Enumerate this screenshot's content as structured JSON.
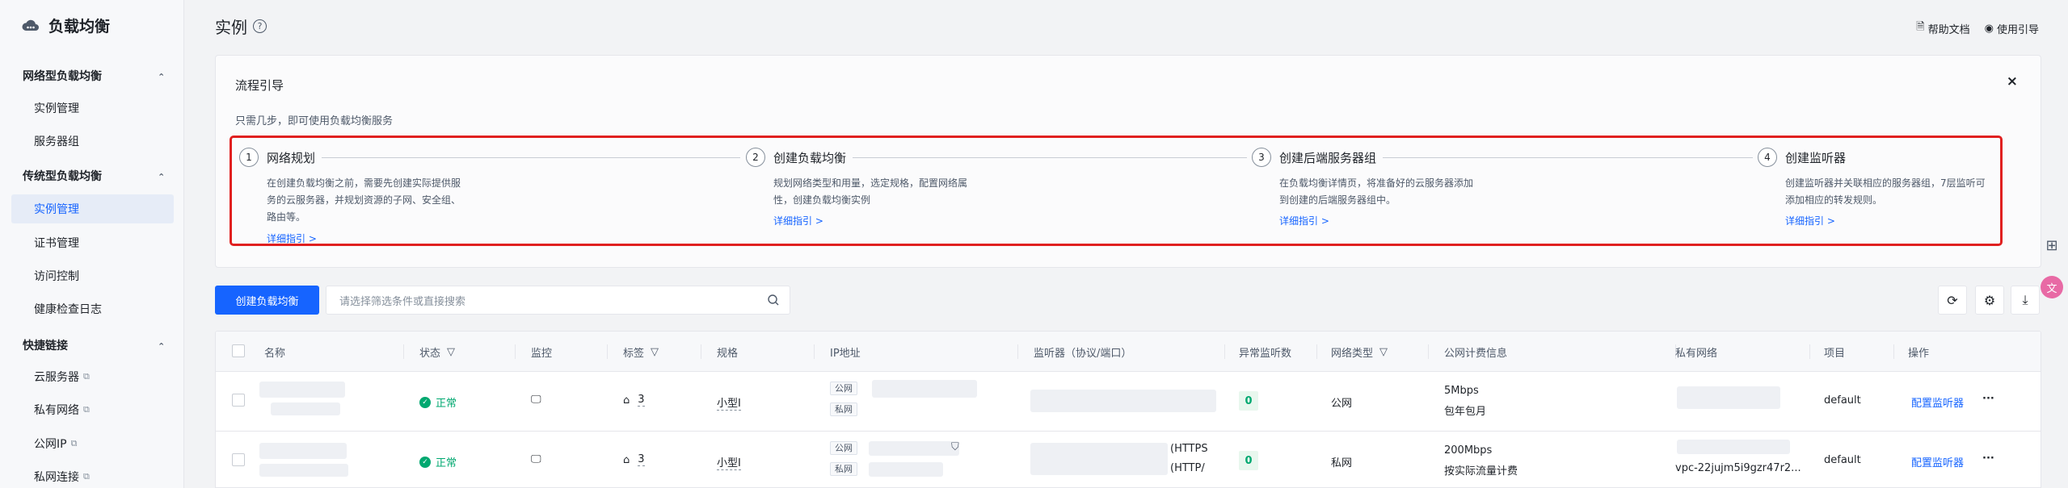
{
  "sidebar": {
    "brand": "负载均衡",
    "groups": [
      {
        "label": "网络型负载均衡",
        "items": [
          {
            "label": "实例管理"
          },
          {
            "label": "服务器组"
          }
        ]
      },
      {
        "label": "传统型负载均衡",
        "items": [
          {
            "label": "实例管理"
          },
          {
            "label": "证书管理"
          },
          {
            "label": "访问控制"
          },
          {
            "label": "健康检查日志"
          }
        ]
      },
      {
        "label": "快捷链接",
        "items": [
          {
            "label": "云服务器"
          },
          {
            "label": "私有网络"
          },
          {
            "label": "公网IP"
          },
          {
            "label": "私网连接"
          }
        ]
      }
    ]
  },
  "header": {
    "title": "实例",
    "help_doc": "帮助文档",
    "usage_guide": "使用引导"
  },
  "guide": {
    "title": "流程引导",
    "subtitle": "只需几步，即可使用负载均衡服务",
    "close": "×",
    "steps": [
      {
        "num": "1",
        "title": "网络规划",
        "desc": "在创建负载均衡之前，需要先创建实际提供服务的云服务器，并规划资源的子网、安全组、路由等。",
        "link": "详细指引 >"
      },
      {
        "num": "2",
        "title": "创建负载均衡",
        "desc": "规划网络类型和用量，选定规格，配置网络属性，创建负载均衡实例",
        "link": "详细指引 >"
      },
      {
        "num": "3",
        "title": "创建后端服务器组",
        "desc": "在负载均衡详情页，将准备好的云服务器添加到创建的后端服务器组中。",
        "link": "详细指引 >"
      },
      {
        "num": "4",
        "title": "创建监听器",
        "desc": "创建监听器并关联相应的服务器组，7层监听可添加相应的转发规则。",
        "link": "详细指引 >"
      }
    ]
  },
  "toolbar": {
    "create_label": "创建负载均衡",
    "search_placeholder": "请选择筛选条件或直接搜索"
  },
  "table": {
    "columns": [
      "名称",
      "状态",
      "监控",
      "标签",
      "规格",
      "IP地址",
      "监听器（协议/端口）",
      "异常监听数",
      "网络类型",
      "公网计费信息",
      "私有网络",
      "项目",
      "操作"
    ],
    "rows": [
      {
        "status": "正常",
        "tags": "3",
        "spec": "小型I",
        "ip_public": "公网",
        "ip_private": "私网",
        "listener_a": "",
        "listener_b": "",
        "abnormal": "0",
        "net_type": "公网",
        "bw": "5Mbps",
        "billing": "包年包月",
        "vpc": "",
        "project": "default",
        "action": "配置监听器",
        "more": "···"
      },
      {
        "status": "正常",
        "tags": "3",
        "spec": "小型I",
        "ip_public": "公网",
        "ip_private": "私网",
        "listener_a": "(HTTPS",
        "listener_b": "(HTTP/",
        "abnormal": "0",
        "net_type": "私网",
        "bw": "200Mbps",
        "billing": "按实际流量计费",
        "vpc": "vpc-22jujm5i9gzr47r2...",
        "project": "default",
        "action": "配置监听器",
        "more": "···"
      }
    ]
  },
  "colors": {
    "primary": "#1664ff",
    "success": "#00a870",
    "highlight_border": "#e02020"
  }
}
